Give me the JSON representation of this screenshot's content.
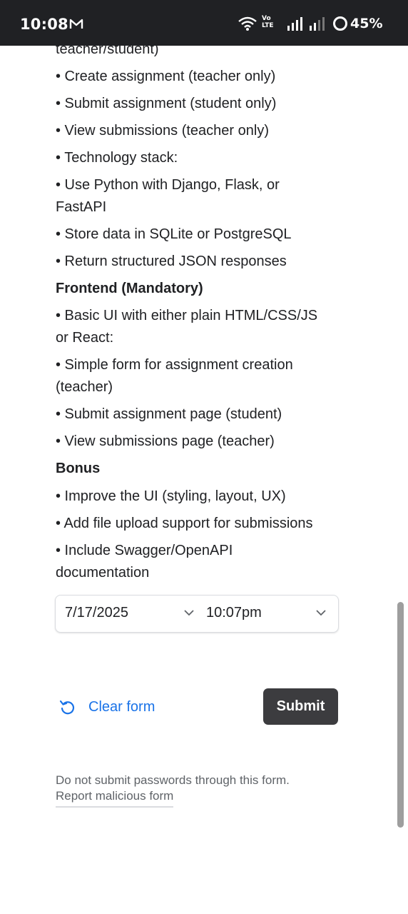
{
  "status_bar": {
    "time": "10:08",
    "volte_line1": "Vo",
    "volte_line2": "LTE",
    "battery": "45%"
  },
  "form": {
    "lines": [
      "teacher/student)",
      "• Create assignment (teacher only)",
      "• Submit assignment (student only)",
      "• View submissions (teacher only)",
      "• Technology stack:",
      "• Use Python with Django, Flask, or",
      "FastAPI",
      "• Store data in SQLite or PostgreSQL",
      "• Return structured JSON responses",
      "Frontend (Mandatory)",
      "• Basic UI with either plain HTML/CSS/JS",
      "or React:",
      "• Simple form for assignment creation",
      "(teacher)",
      "• Submit assignment page (student)",
      "• View submissions page (teacher)",
      "Bonus",
      "• Improve the UI (styling, layout, UX)",
      "• Add file upload support for submissions",
      "• Include Swagger/OpenAPI",
      "documentation"
    ],
    "date_value": "7/17/2025",
    "time_value": "10:07pm",
    "clear_label": "Clear form",
    "submit_label": "Submit",
    "footer_note": "Do not submit passwords through this form.",
    "report_link": "Report malicious form"
  },
  "colors": {
    "link_blue": "#1a73e8",
    "submit_bg": "#3c3c3f",
    "status_bar_bg": "#202124"
  }
}
